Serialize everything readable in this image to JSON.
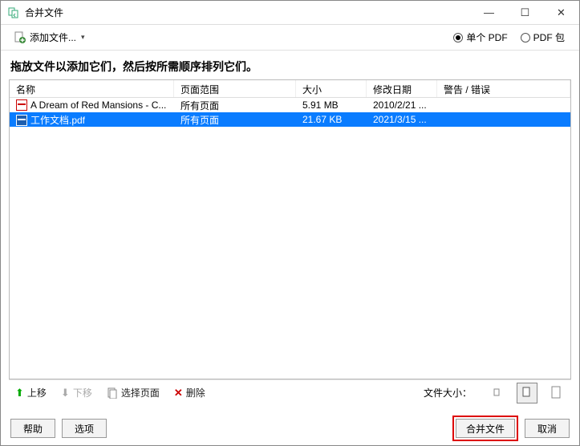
{
  "titlebar": {
    "title": "合并文件"
  },
  "toolbar": {
    "add_files_label": "添加文件...",
    "radio_single": "单个 PDF",
    "radio_package": "PDF 包"
  },
  "instructions": "拖放文件以添加它们，然后按所需顺序排列它们。",
  "columns": {
    "name": "名称",
    "range": "页面范围",
    "size": "大小",
    "date": "修改日期",
    "warn": "警告 / 错误"
  },
  "rows": [
    {
      "name": "A Dream of Red Mansions - C...",
      "range": "所有页面",
      "size": "5.91 MB",
      "date": "2010/2/21 ...",
      "selected": false
    },
    {
      "name": "工作文档.pdf",
      "range": "所有页面",
      "size": "21.67 KB",
      "date": "2021/3/15 ...",
      "selected": true
    }
  ],
  "lower": {
    "move_up": "上移",
    "move_down": "下移",
    "select_pages": "选择页面",
    "delete": "删除",
    "filesize_label": "文件大小："
  },
  "footer": {
    "help": "帮助",
    "options": "选项",
    "merge": "合并文件",
    "cancel": "取消"
  }
}
